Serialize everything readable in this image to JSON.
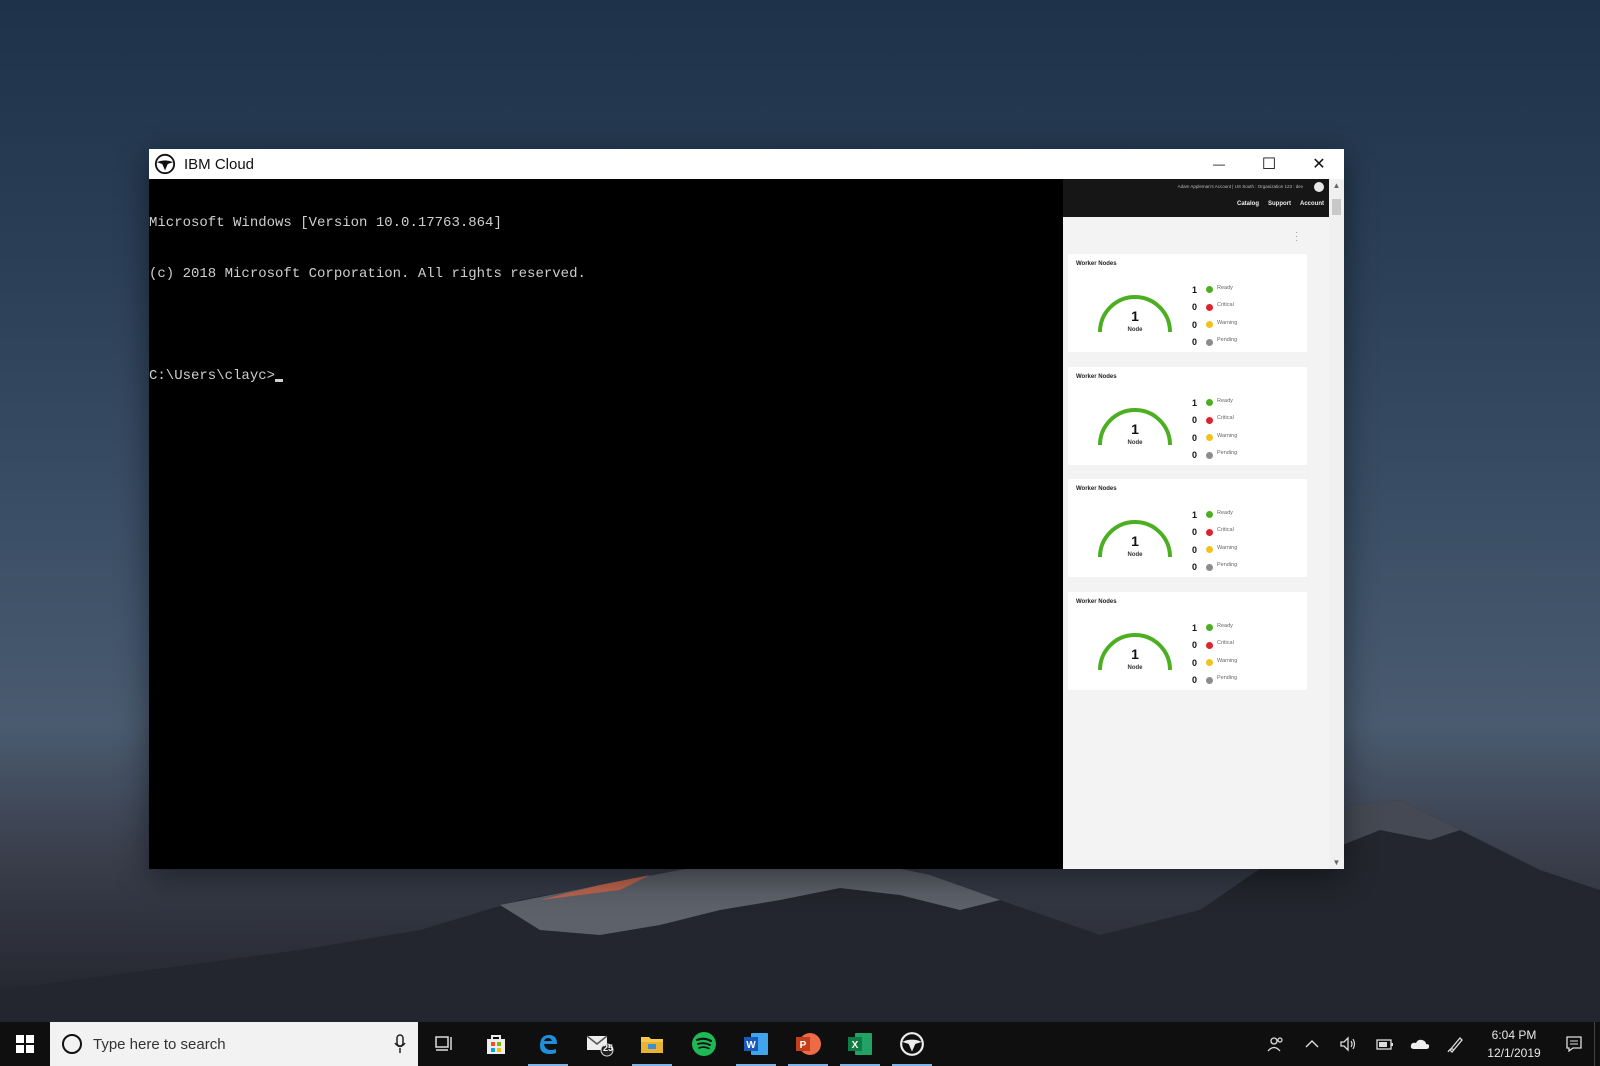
{
  "window": {
    "title": "IBM Cloud",
    "minimize": "—",
    "maximize": "☐",
    "close": "✕"
  },
  "terminal": {
    "lines": [
      "Microsoft Windows [Version 10.0.17763.864]",
      "(c) 2018 Microsoft Corporation. All rights reserved.",
      "",
      "C:\\Users\\clayc>"
    ]
  },
  "panel": {
    "account": "Adam Appleman's Account  |  US South : Organization 123 : dev",
    "nav": [
      "Catalog",
      "Support",
      "Account"
    ],
    "cards": [
      {
        "title": "Worker Nodes",
        "gauge_value": "1",
        "gauge_label": "Node",
        "legend": [
          {
            "count": "1",
            "label": "Ready"
          },
          {
            "count": "0",
            "label": "Critical"
          },
          {
            "count": "0",
            "label": "Warning"
          },
          {
            "count": "0",
            "label": "Pending"
          }
        ]
      },
      {
        "title": "Worker Nodes",
        "gauge_value": "1",
        "gauge_label": "Node",
        "legend": [
          {
            "count": "1",
            "label": "Ready"
          },
          {
            "count": "0",
            "label": "Critical"
          },
          {
            "count": "0",
            "label": "Warning"
          },
          {
            "count": "0",
            "label": "Pending"
          }
        ]
      },
      {
        "title": "Worker Nodes",
        "gauge_value": "1",
        "gauge_label": "Node",
        "legend": [
          {
            "count": "1",
            "label": "Ready"
          },
          {
            "count": "0",
            "label": "Critical"
          },
          {
            "count": "0",
            "label": "Warning"
          },
          {
            "count": "0",
            "label": "Pending"
          }
        ]
      },
      {
        "title": "Worker Nodes",
        "gauge_value": "1",
        "gauge_label": "Node",
        "legend": [
          {
            "count": "1",
            "label": "Ready"
          },
          {
            "count": "0",
            "label": "Critical"
          },
          {
            "count": "0",
            "label": "Warning"
          },
          {
            "count": "0",
            "label": "Pending"
          }
        ]
      }
    ],
    "status_colors": {
      "Ready": "#4caf22",
      "Critical": "#e0242c",
      "Warning": "#f1c21b",
      "Pending": "#8c8c8c"
    },
    "gauge_color": "#4caf22"
  },
  "taskbar": {
    "search_placeholder": "Type here to search",
    "apps": [
      "task-view-icon",
      "store-icon",
      "edge-icon",
      "mail-icon",
      "file-explorer-icon",
      "spotify-icon",
      "word-icon",
      "powerpoint-icon",
      "excel-icon",
      "ibm-cloud-icon"
    ],
    "mail_badge": "25",
    "clock_time": "6:04 PM",
    "clock_date": "12/1/2019"
  }
}
